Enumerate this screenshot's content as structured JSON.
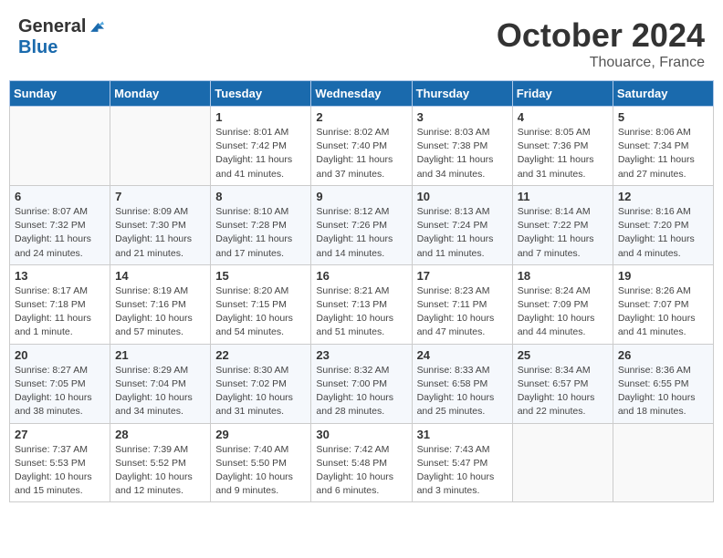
{
  "logo": {
    "general": "General",
    "blue": "Blue"
  },
  "header": {
    "month": "October 2024",
    "location": "Thouarce, France"
  },
  "weekdays": [
    "Sunday",
    "Monday",
    "Tuesday",
    "Wednesday",
    "Thursday",
    "Friday",
    "Saturday"
  ],
  "weeks": [
    [
      {
        "day": "",
        "info": ""
      },
      {
        "day": "",
        "info": ""
      },
      {
        "day": "1",
        "info": "Sunrise: 8:01 AM\nSunset: 7:42 PM\nDaylight: 11 hours and 41 minutes."
      },
      {
        "day": "2",
        "info": "Sunrise: 8:02 AM\nSunset: 7:40 PM\nDaylight: 11 hours and 37 minutes."
      },
      {
        "day": "3",
        "info": "Sunrise: 8:03 AM\nSunset: 7:38 PM\nDaylight: 11 hours and 34 minutes."
      },
      {
        "day": "4",
        "info": "Sunrise: 8:05 AM\nSunset: 7:36 PM\nDaylight: 11 hours and 31 minutes."
      },
      {
        "day": "5",
        "info": "Sunrise: 8:06 AM\nSunset: 7:34 PM\nDaylight: 11 hours and 27 minutes."
      }
    ],
    [
      {
        "day": "6",
        "info": "Sunrise: 8:07 AM\nSunset: 7:32 PM\nDaylight: 11 hours and 24 minutes."
      },
      {
        "day": "7",
        "info": "Sunrise: 8:09 AM\nSunset: 7:30 PM\nDaylight: 11 hours and 21 minutes."
      },
      {
        "day": "8",
        "info": "Sunrise: 8:10 AM\nSunset: 7:28 PM\nDaylight: 11 hours and 17 minutes."
      },
      {
        "day": "9",
        "info": "Sunrise: 8:12 AM\nSunset: 7:26 PM\nDaylight: 11 hours and 14 minutes."
      },
      {
        "day": "10",
        "info": "Sunrise: 8:13 AM\nSunset: 7:24 PM\nDaylight: 11 hours and 11 minutes."
      },
      {
        "day": "11",
        "info": "Sunrise: 8:14 AM\nSunset: 7:22 PM\nDaylight: 11 hours and 7 minutes."
      },
      {
        "day": "12",
        "info": "Sunrise: 8:16 AM\nSunset: 7:20 PM\nDaylight: 11 hours and 4 minutes."
      }
    ],
    [
      {
        "day": "13",
        "info": "Sunrise: 8:17 AM\nSunset: 7:18 PM\nDaylight: 11 hours and 1 minute."
      },
      {
        "day": "14",
        "info": "Sunrise: 8:19 AM\nSunset: 7:16 PM\nDaylight: 10 hours and 57 minutes."
      },
      {
        "day": "15",
        "info": "Sunrise: 8:20 AM\nSunset: 7:15 PM\nDaylight: 10 hours and 54 minutes."
      },
      {
        "day": "16",
        "info": "Sunrise: 8:21 AM\nSunset: 7:13 PM\nDaylight: 10 hours and 51 minutes."
      },
      {
        "day": "17",
        "info": "Sunrise: 8:23 AM\nSunset: 7:11 PM\nDaylight: 10 hours and 47 minutes."
      },
      {
        "day": "18",
        "info": "Sunrise: 8:24 AM\nSunset: 7:09 PM\nDaylight: 10 hours and 44 minutes."
      },
      {
        "day": "19",
        "info": "Sunrise: 8:26 AM\nSunset: 7:07 PM\nDaylight: 10 hours and 41 minutes."
      }
    ],
    [
      {
        "day": "20",
        "info": "Sunrise: 8:27 AM\nSunset: 7:05 PM\nDaylight: 10 hours and 38 minutes."
      },
      {
        "day": "21",
        "info": "Sunrise: 8:29 AM\nSunset: 7:04 PM\nDaylight: 10 hours and 34 minutes."
      },
      {
        "day": "22",
        "info": "Sunrise: 8:30 AM\nSunset: 7:02 PM\nDaylight: 10 hours and 31 minutes."
      },
      {
        "day": "23",
        "info": "Sunrise: 8:32 AM\nSunset: 7:00 PM\nDaylight: 10 hours and 28 minutes."
      },
      {
        "day": "24",
        "info": "Sunrise: 8:33 AM\nSunset: 6:58 PM\nDaylight: 10 hours and 25 minutes."
      },
      {
        "day": "25",
        "info": "Sunrise: 8:34 AM\nSunset: 6:57 PM\nDaylight: 10 hours and 22 minutes."
      },
      {
        "day": "26",
        "info": "Sunrise: 8:36 AM\nSunset: 6:55 PM\nDaylight: 10 hours and 18 minutes."
      }
    ],
    [
      {
        "day": "27",
        "info": "Sunrise: 7:37 AM\nSunset: 5:53 PM\nDaylight: 10 hours and 15 minutes."
      },
      {
        "day": "28",
        "info": "Sunrise: 7:39 AM\nSunset: 5:52 PM\nDaylight: 10 hours and 12 minutes."
      },
      {
        "day": "29",
        "info": "Sunrise: 7:40 AM\nSunset: 5:50 PM\nDaylight: 10 hours and 9 minutes."
      },
      {
        "day": "30",
        "info": "Sunrise: 7:42 AM\nSunset: 5:48 PM\nDaylight: 10 hours and 6 minutes."
      },
      {
        "day": "31",
        "info": "Sunrise: 7:43 AM\nSunset: 5:47 PM\nDaylight: 10 hours and 3 minutes."
      },
      {
        "day": "",
        "info": ""
      },
      {
        "day": "",
        "info": ""
      }
    ]
  ]
}
